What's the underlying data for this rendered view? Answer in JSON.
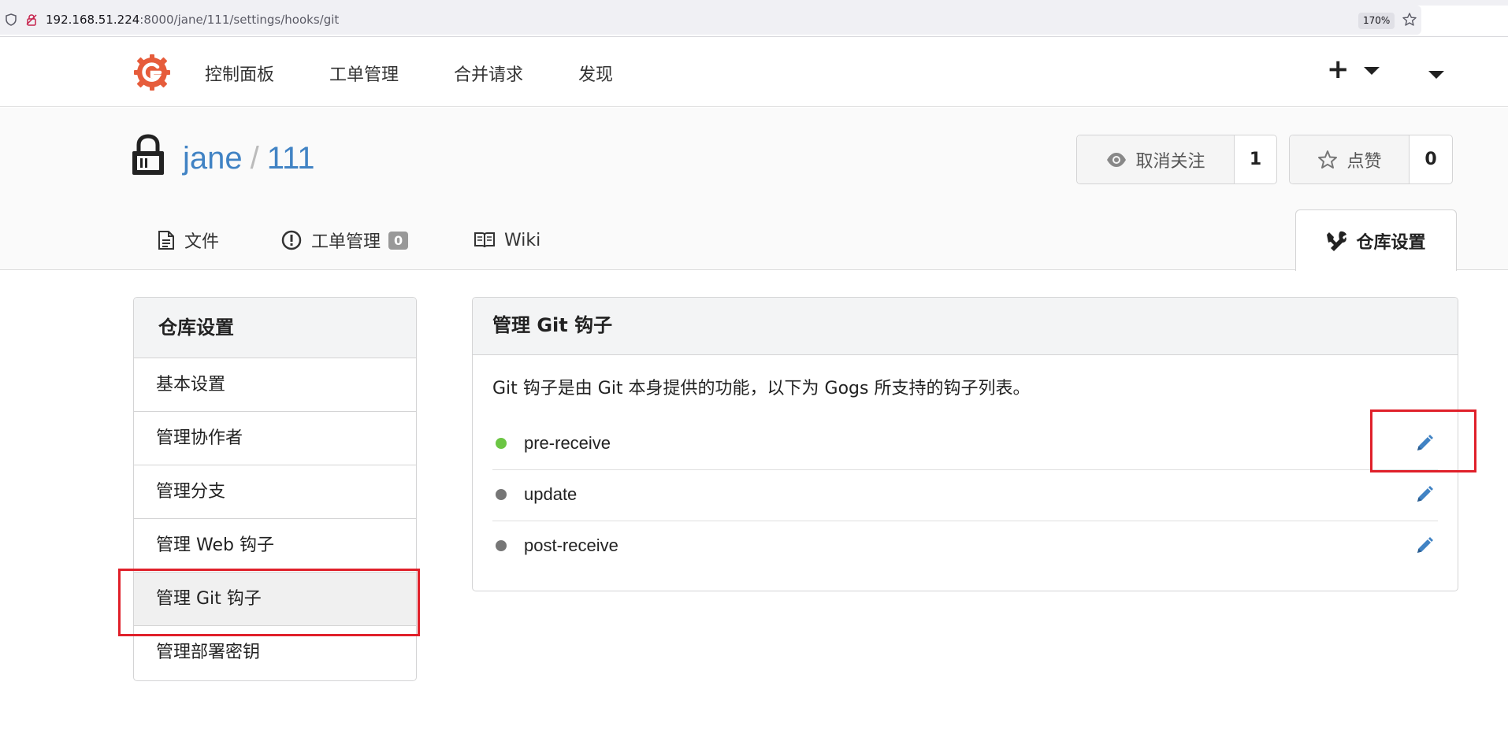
{
  "browser": {
    "url_host": "192.168.51.224",
    "url_path": ":8000/jane/111/settings/hooks/git",
    "zoom": "170%"
  },
  "topnav": {
    "items": [
      "控制面板",
      "工单管理",
      "合并请求",
      "发现"
    ],
    "plus_label": "+"
  },
  "repo": {
    "owner": "jane",
    "separator": "/",
    "name": "111",
    "watch_label": "取消关注",
    "watch_count": "1",
    "star_label": "点赞",
    "star_count": "0"
  },
  "tabs": {
    "files": "文件",
    "issues": "工单管理",
    "issues_count": "0",
    "wiki": "Wiki",
    "settings": "仓库设置"
  },
  "sidebar": {
    "title": "仓库设置",
    "items": [
      "基本设置",
      "管理协作者",
      "管理分支",
      "管理 Web 钩子",
      "管理 Git 钩子",
      "管理部署密钥"
    ],
    "active_index": 4
  },
  "panel": {
    "title": "管理 Git 钩子",
    "description": "Git 钩子是由 Git 本身提供的功能，以下为 Gogs 所支持的钩子列表。",
    "hooks": [
      {
        "name": "pre-receive",
        "status_color": "#6cc644"
      },
      {
        "name": "update",
        "status_color": "#767676"
      },
      {
        "name": "post-receive",
        "status_color": "#767676"
      }
    ]
  },
  "colors": {
    "link": "#4183c4",
    "highlight": "#e0202a",
    "logo": "#e65c3b"
  }
}
